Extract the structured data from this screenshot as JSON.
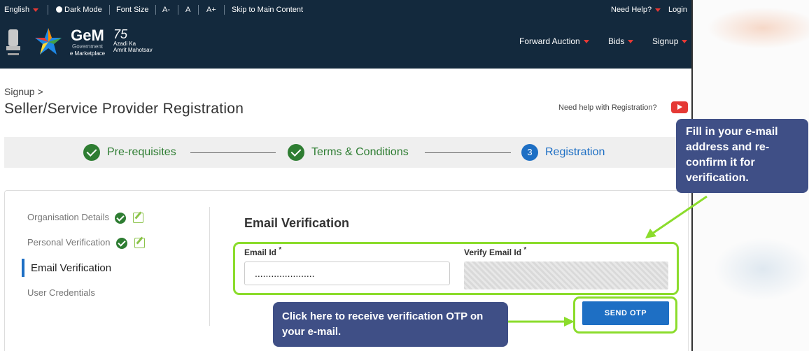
{
  "topbar": {
    "language": "English",
    "dark_mode": "Dark Mode",
    "font_size": "Font Size",
    "font_dec": "A-",
    "font_normal": "A",
    "font_inc": "A+",
    "skip": "Skip to Main Content",
    "need_help": "Need Help?",
    "login": "Login"
  },
  "header": {
    "logo_title": "GeM",
    "logo_sub1": "Government",
    "logo_sub2": "e Marketplace",
    "azadi_line1": "75",
    "azadi_line2": "Azadi Ka",
    "azadi_line3": "Amrit Mahotsav",
    "nav": [
      "Forward Auction",
      "Bids",
      "Signup"
    ]
  },
  "page": {
    "breadcrumb": "Signup >",
    "title": "Seller/Service Provider Registration",
    "help_text": "Need help with Registration?"
  },
  "steps": [
    {
      "label": "Pre-requisites",
      "state": "done"
    },
    {
      "label": "Terms & Conditions",
      "state": "done"
    },
    {
      "label": "Registration",
      "state": "current",
      "number": "3"
    }
  ],
  "sidebar": [
    {
      "label": "Organisation Details",
      "state": "done"
    },
    {
      "label": "Personal Verification",
      "state": "done"
    },
    {
      "label": "Email Verification",
      "state": "active"
    },
    {
      "label": "User Credentials",
      "state": "pending"
    }
  ],
  "form": {
    "section_title": "Email Verification",
    "email_label": "Email Id",
    "verify_label": "Verify Email Id",
    "required_mark": "*",
    "email_value": "......................",
    "send_otp": "SEND OTP"
  },
  "callouts": {
    "right": "Fill in your e-mail address and re-confirm it for verification.",
    "bottom": "Click here to receive verification OTP on your e-mail."
  },
  "colors": {
    "header_bg": "#13293d",
    "accent_blue": "#1e6fc4",
    "success_green": "#2e7d32",
    "highlight_green": "#8bdc2c",
    "callout_bg": "#3f4f86"
  }
}
